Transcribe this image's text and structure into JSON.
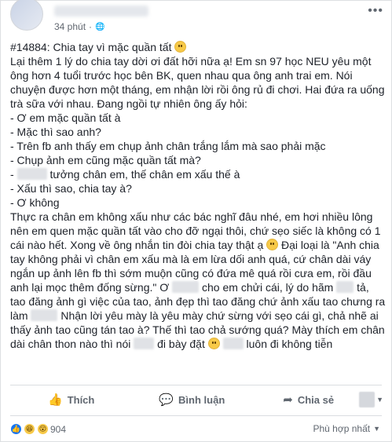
{
  "header": {
    "time": "34 phút",
    "more": "•••"
  },
  "post": {
    "title": "#14884: Chia tay vì mặc quần tất",
    "p1": "Lại thêm 1 lý do chia tay dời ơi đất hỡi nữa ạ! Em sn 97 học NEU yêu một ông hơn 4 tuổi trước học bên BK, quen nhau qua ông anh trai em. Nói chuyện được hơn một tháng, em nhận lời rồi ông rủ đi chơi. Hai đứa ra uống trà sữa với nhau. Đang ngồi tự nhiên ông ấy hỏi:",
    "d1": "- Ơ em mặc quần tất à",
    "d2": "- Mặc thì sao anh?",
    "d3": "- Trên fb anh thấy em chụp ảnh chân trắng lắm mà sao phải mặc",
    "d4": "- Chụp ảnh em cũng mặc quần tất mà?",
    "d5": "tưởng chân em, thế chân em xấu thế à",
    "d6": "- Xấu thì sao, chia tay à?",
    "d7": "- Ơ không",
    "p2a": "Thực ra chân em không xấu như các bác nghĩ đâu nhé, em hơi nhiều lông nên em quen mặc quần tất vào cho đỡ ngại thôi, chứ sẹo siếc là không có 1 cái nào hết. Xong về ông nhắn tin đòi chia tay thật ạ",
    "p2b": "Đại loại là \"Anh chia tay không phải vì chân em xấu mà là em lừa dối anh quá, cứ chân dài váy ngắn up ảnh lên fb thì sớm muộn cũng có đứa mê quá rồi cưa em, rồi đầu anh lại mọc thêm đống sừng.\" Ơ",
    "p2c": "cho em chửi cái, lý do hãm",
    "p2d": "tả, tao đăng ảnh gì việc của tao, ảnh đẹp thì tao đăng chứ ảnh xấu tao chưng ra làm",
    "p2e": "Nhận lời yêu mày là yêu mày chứ sừng với sẹo cái gì, chả nhẽ ai thấy ảnh tao cũng tán tao à? Thế thì tao chả sướng quá? Mày thích em chân dài chân thon nào thì nói",
    "p2f": "đi bày đặt",
    "p2g": "luôn đi không tiễn"
  },
  "actions": {
    "like": "Thích",
    "comment": "Bình luận",
    "share": "Chia sẻ"
  },
  "reactions": {
    "count": "904",
    "sort": "Phù hợp nhất"
  }
}
